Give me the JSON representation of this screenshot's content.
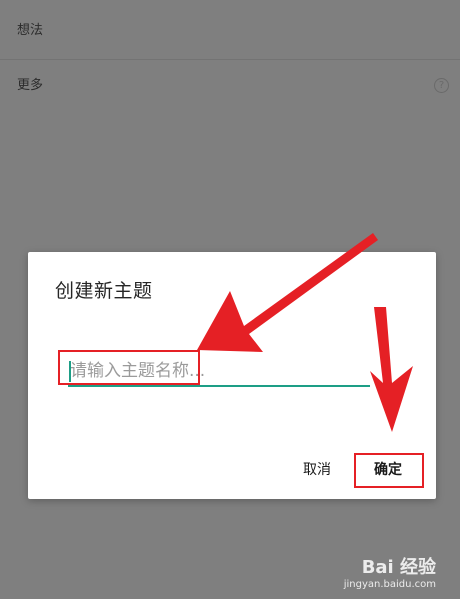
{
  "background_list": {
    "items": [
      {
        "label": "想法"
      },
      {
        "label": "更多",
        "trailing_icon": "question-circle-icon",
        "trailing_glyph": "?"
      }
    ]
  },
  "dialog": {
    "title": "创建新主题",
    "input": {
      "value": "",
      "placeholder": "请输入主题名称..."
    },
    "cancel_label": "取消",
    "confirm_label": "确定"
  },
  "watermark": {
    "logo_text": "Bai 经验",
    "url": "jingyan.baidu.com"
  },
  "colors": {
    "overlay_background": "#7f7f7f",
    "dialog_background": "#ffffff",
    "accent_teal": "#1d9e86",
    "annotation_red": "#e52025"
  }
}
